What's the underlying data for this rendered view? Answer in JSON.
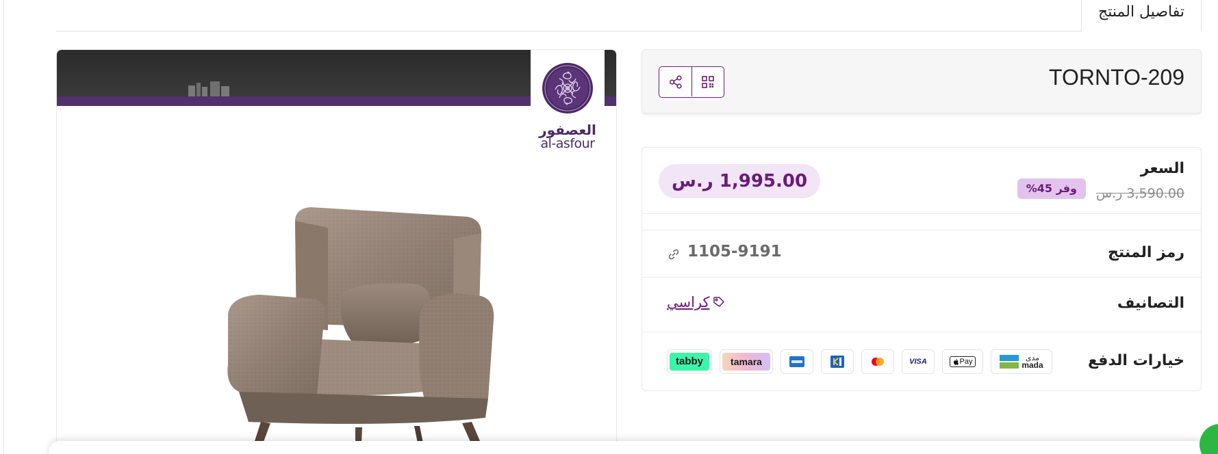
{
  "tabs": {
    "active_label": "تفاصيل المنتج"
  },
  "image": {
    "logo_ar": "العصفور",
    "logo_en": "al-asfour"
  },
  "product": {
    "title": "TORNTO-209",
    "actions": [
      {
        "name": "share",
        "icon": "share-icon"
      },
      {
        "name": "qr-code",
        "icon": "qr-code-icon"
      }
    ]
  },
  "price": {
    "label": "السعر",
    "old_price": "3,590.00 ر.س",
    "discount": "وفر 45%",
    "current_price": "1,995.00 ر.س"
  },
  "sku": {
    "label": "رمز المنتج",
    "value": "1105-9191",
    "icon": "link-icon"
  },
  "categories": {
    "label": "التصانيف",
    "items": [
      {
        "label": "كراسي",
        "icon": "tag-icon"
      }
    ]
  },
  "payment": {
    "label": "خيارات الدفع",
    "mada_ar": "مدى",
    "mada_en": "mada",
    "applepay": "Pay",
    "visa": "VISA",
    "tamara": "tamara",
    "tabby": "tabby",
    "methods": [
      "mada",
      "apple-pay",
      "visa",
      "mastercard",
      "stc-pay",
      "american-express",
      "tamara",
      "tabby"
    ]
  },
  "colors": {
    "brand_purple": "#6a1b79",
    "price_bg": "#f1e5f6",
    "discount_bg": "#e3c3ee",
    "tabby_green": "#3bf5a8"
  }
}
